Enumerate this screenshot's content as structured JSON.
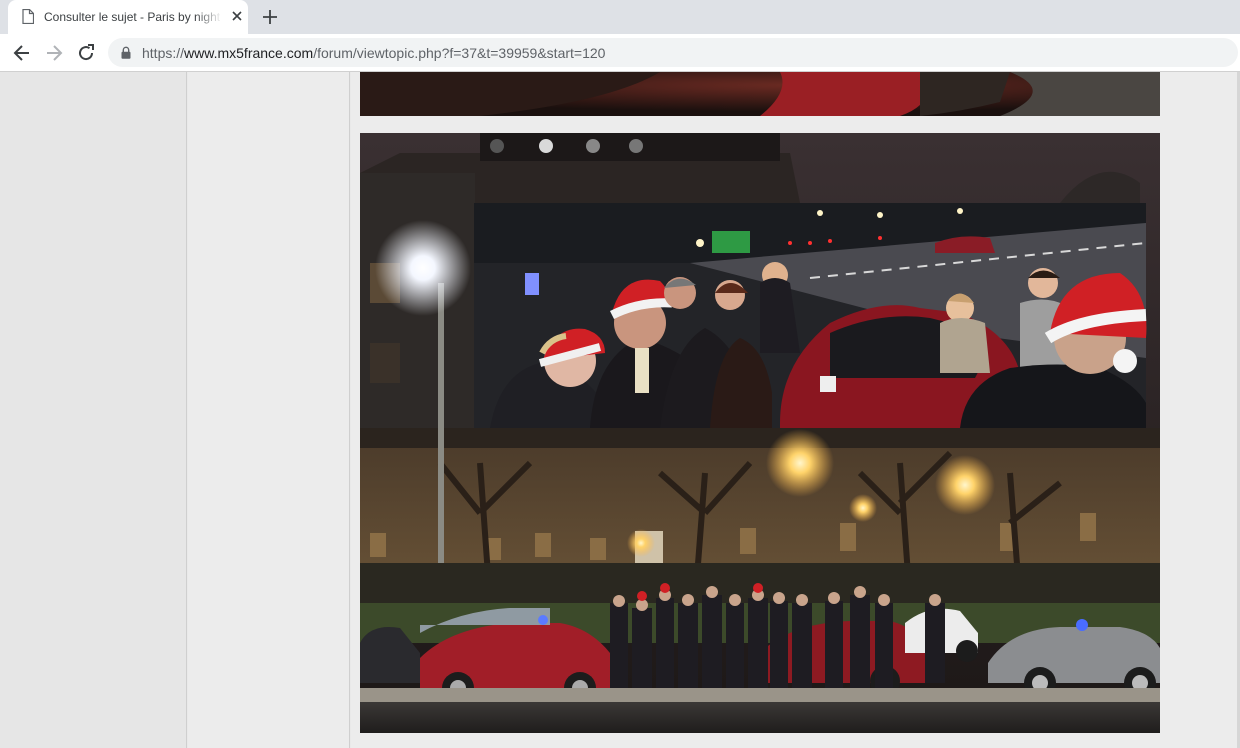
{
  "browser": {
    "tab": {
      "title": "Consulter le sujet - Paris by night"
    },
    "icons": {
      "tab": "page-icon",
      "close": "close-icon",
      "new_tab": "plus-icon",
      "back": "arrow-left-icon",
      "forward": "arrow-right-icon",
      "reload": "reload-icon",
      "secure": "lock-icon"
    },
    "url": {
      "scheme": "https://",
      "host": "www.mx5france.com",
      "path": "/forum/viewtopic.php?f=37&t=39959&start=120"
    }
  },
  "post": {
    "images": [
      {
        "kind": "photo-fragment"
      },
      {
        "kind": "photo-collage"
      }
    ]
  },
  "colors": {
    "chrome_bg": "#dee1e6",
    "page_bg": "#e9e9e9",
    "car_red": "#8e1a22",
    "santa_red": "#d02025"
  }
}
